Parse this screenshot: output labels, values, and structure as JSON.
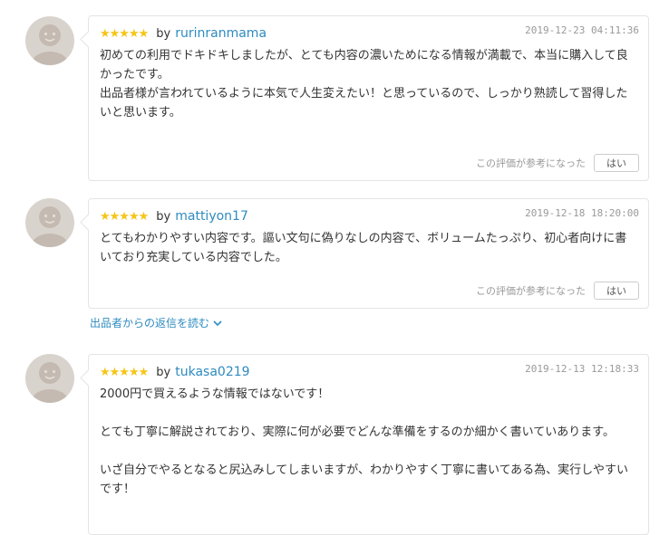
{
  "reviews": [
    {
      "stars": "★★★★★",
      "by": "by",
      "user": "rurinranmama",
      "date": "2019-12-23 04:11:36",
      "text": "初めての利用でドキドキしましたが、とても内容の濃いためになる情報が満載で、本当に購入して良かったです。\n出品者様が言われているように本気で人生変えたい！と思っているので、しっかり熟読して習得したいと思います。",
      "helpful_label": "この評価が参考になった",
      "helpful_button": "はい"
    },
    {
      "stars": "★★★★★",
      "by": "by",
      "user": "mattiyon17",
      "date": "2019-12-18 18:20:00",
      "text": "とてもわかりやすい内容です。謳い文句に偽りなしの内容で、ボリュームたっぷり、初心者向けに書いており充実している内容でした。",
      "helpful_label": "この評価が参考になった",
      "helpful_button": "はい"
    },
    {
      "stars": "★★★★★",
      "by": "by",
      "user": "tukasa0219",
      "date": "2019-12-13 12:18:33",
      "text": "2000円で買えるような情報ではないです！\n\nとても丁寧に解説されており、実際に何が必要でどんな準備をするのか細かく書いていあります。\n\nいざ自分でやるとなると尻込みしてしまいますが、わかりやすく丁寧に書いてある為、実行しやすいです！"
    }
  ],
  "reply_link": "出品者からの返信を読む",
  "colors": {
    "link": "#2e8bc0",
    "star": "#f5c518",
    "muted": "#999999",
    "border": "#e4e4e4",
    "avatar": "#d9d3cd"
  },
  "icons": {
    "avatar": "user-avatar-icon",
    "reply_chevron": "chevron-down-icon"
  }
}
